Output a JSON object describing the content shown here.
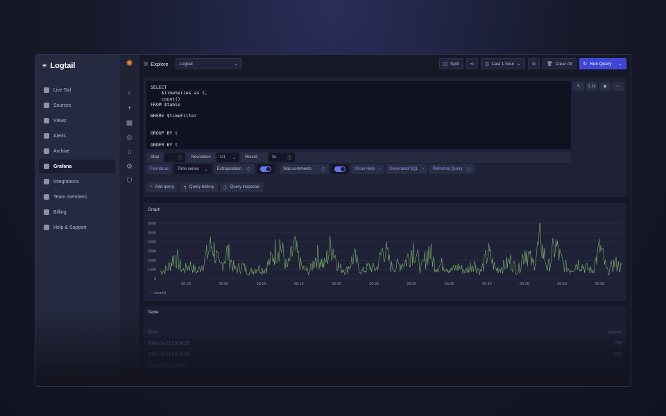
{
  "sidebar": {
    "brand": "Logtail",
    "items": [
      {
        "label": "Live Tail",
        "icon": "terminal-icon"
      },
      {
        "label": "Sources",
        "icon": "database-icon"
      },
      {
        "label": "Views",
        "icon": "eye-icon"
      },
      {
        "label": "Alerts",
        "icon": "alert-icon"
      },
      {
        "label": "Archive",
        "icon": "archive-icon"
      },
      {
        "label": "Grafana",
        "icon": "grafana-icon",
        "active": true
      },
      {
        "label": "Integrations",
        "icon": "integrations-icon"
      },
      {
        "label": "Team members",
        "icon": "team-icon"
      },
      {
        "label": "Billing",
        "icon": "billing-icon"
      },
      {
        "label": "Help & Support",
        "icon": "help-icon"
      }
    ]
  },
  "toolbar": {
    "title": "Explore",
    "datasource": "Logtail",
    "split": "Split",
    "time_range": "Last 1 hour",
    "clear": "Clear All",
    "run": "Run Query"
  },
  "editor": {
    "query": "SELECT\n    $timeSeries as t,\n    count()\nFROM $table\n\nWHERE $timeFilter\n\n\nGROUP BY t\n\nORDER BY t",
    "zoom": "1.1x"
  },
  "options": {
    "step": "Step",
    "resolution": "Resolution",
    "resolution_value": "1/1",
    "round": "Round",
    "round_value": "0s",
    "format_as": "Format as",
    "format_value": "Time series",
    "extrapolation": "Extrapolation",
    "skip_comments": "Skip comments",
    "show_help": "Show Help",
    "generated_sql": "Generated SQL",
    "reformat": "Reformat Query"
  },
  "actions": {
    "add_query": "Add query",
    "history": "Query history",
    "inspector": "Query inspector"
  },
  "graph": {
    "title": "Graph",
    "legend": "count()"
  },
  "chart_data": {
    "type": "line",
    "title": "Graph",
    "x_ticks": [
      "00:00",
      "00:05",
      "00:10",
      "00:15",
      "00:20",
      "00:25",
      "00:30",
      "00:35",
      "00:40",
      "00:45",
      "00:50",
      "00:55"
    ],
    "y_ticks": [
      0,
      1000,
      2000,
      3000,
      4000,
      5000,
      6000
    ],
    "ylim": [
      0,
      6000
    ],
    "series": [
      {
        "name": "count()",
        "color": "#7eb26d",
        "values": [
          900,
          1400,
          3200,
          1100,
          1800,
          900,
          2600,
          4700,
          1500,
          3600,
          1200,
          1700,
          900,
          1500,
          1200,
          2800,
          5000,
          1400,
          4200,
          1500,
          900,
          3200,
          1800,
          4700,
          1500,
          1100,
          3000,
          900,
          1600,
          1300,
          4300,
          1600,
          1800,
          2400,
          4500,
          1200,
          3900,
          1600,
          2000,
          1100,
          1600,
          1000,
          2200,
          900,
          3500,
          1300,
          1600,
          2400,
          1000,
          4100,
          1800,
          5200,
          1300,
          4600,
          2000,
          1200,
          2200,
          1500,
          1000,
          4200,
          900,
          2100,
          1400
        ]
      }
    ]
  },
  "table": {
    "title": "Table",
    "columns": [
      "Time",
      "count()"
    ],
    "rows": [
      [
        "2021-01-21 23:58:35",
        "776"
      ],
      [
        "2021-01-21 23:58:34",
        "585"
      ],
      [
        "2021-01-21 23:58:33",
        "771"
      ]
    ]
  }
}
